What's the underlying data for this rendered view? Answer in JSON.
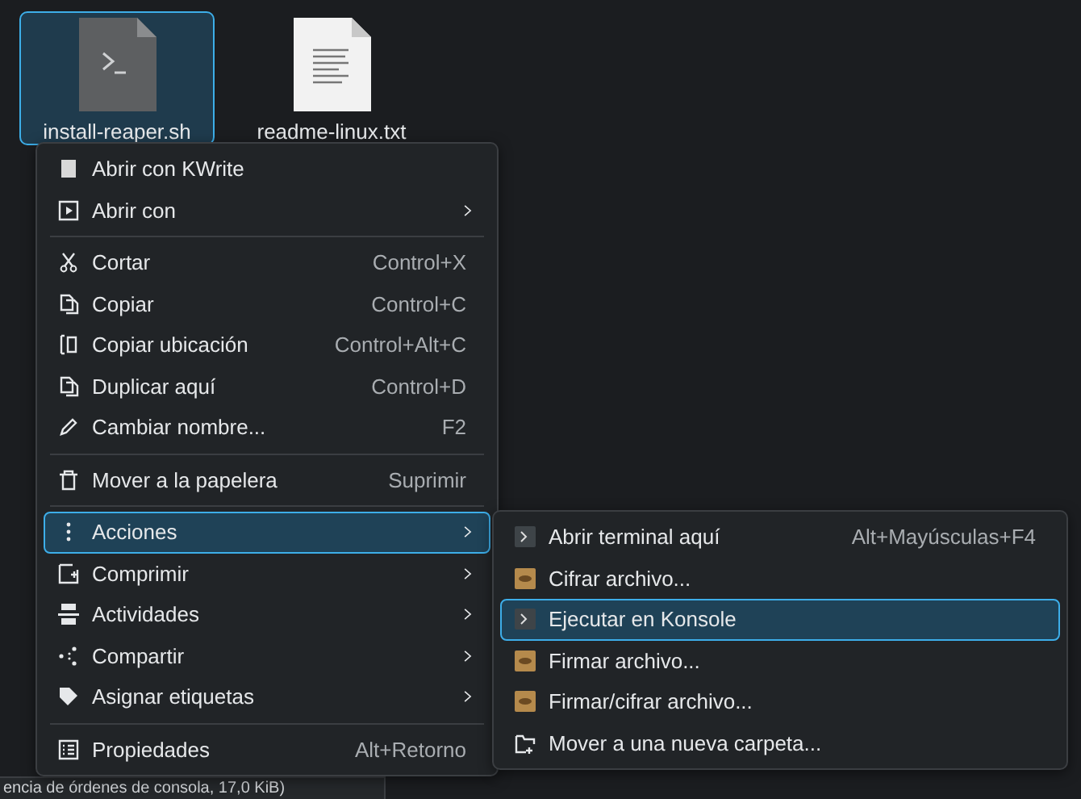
{
  "desktop_files": [
    {
      "name": "install-reaper.sh",
      "kind": "script",
      "selected": true
    },
    {
      "name": "readme-linux.txt",
      "kind": "text",
      "selected": false
    }
  ],
  "context_menu": {
    "items": [
      {
        "kind": "item",
        "label": "Abrir con KWrite",
        "submenu": false,
        "selected": false
      },
      {
        "kind": "item",
        "label": "Abrir con",
        "submenu": true,
        "selected": false
      },
      {
        "kind": "separator"
      },
      {
        "kind": "item",
        "label": "Cortar",
        "shortcut": "Control+X",
        "submenu": false,
        "selected": false
      },
      {
        "kind": "item",
        "label": "Copiar",
        "shortcut": "Control+C",
        "submenu": false,
        "selected": false
      },
      {
        "kind": "item",
        "label": "Copiar ubicación",
        "shortcut": "Control+Alt+C",
        "submenu": false,
        "selected": false
      },
      {
        "kind": "item",
        "label": "Duplicar aquí",
        "shortcut": "Control+D",
        "submenu": false,
        "selected": false
      },
      {
        "kind": "item",
        "label": "Cambiar nombre...",
        "shortcut": "F2",
        "submenu": false,
        "selected": false
      },
      {
        "kind": "separator"
      },
      {
        "kind": "item",
        "label": "Mover a la papelera",
        "shortcut": "Suprimir",
        "submenu": false,
        "selected": false
      },
      {
        "kind": "separator"
      },
      {
        "kind": "item",
        "label": "Acciones",
        "submenu": true,
        "selected": true
      },
      {
        "kind": "item",
        "label": "Comprimir",
        "submenu": true,
        "selected": false
      },
      {
        "kind": "item",
        "label": "Actividades",
        "submenu": true,
        "selected": false
      },
      {
        "kind": "item",
        "label": "Compartir",
        "submenu": true,
        "selected": false
      },
      {
        "kind": "item",
        "label": "Asignar etiquetas",
        "submenu": true,
        "selected": false
      },
      {
        "kind": "separator"
      },
      {
        "kind": "item",
        "label": "Propiedades",
        "shortcut": "Alt+Retorno",
        "submenu": false,
        "selected": false
      }
    ]
  },
  "actions_submenu": {
    "items": [
      {
        "label": "Abrir terminal aquí",
        "shortcut": "Alt+Mayúsculas+F4",
        "selected": false
      },
      {
        "label": "Cifrar archivo...",
        "selected": false
      },
      {
        "label": "Ejecutar en Konsole",
        "selected": true
      },
      {
        "label": "Firmar archivo...",
        "selected": false
      },
      {
        "label": "Firmar/cifrar archivo...",
        "selected": false
      },
      {
        "label": "Mover a una nueva carpeta...",
        "selected": false
      }
    ]
  },
  "status_bar": {
    "text": "encia de órdenes de consola, 17,0 KiB)"
  }
}
